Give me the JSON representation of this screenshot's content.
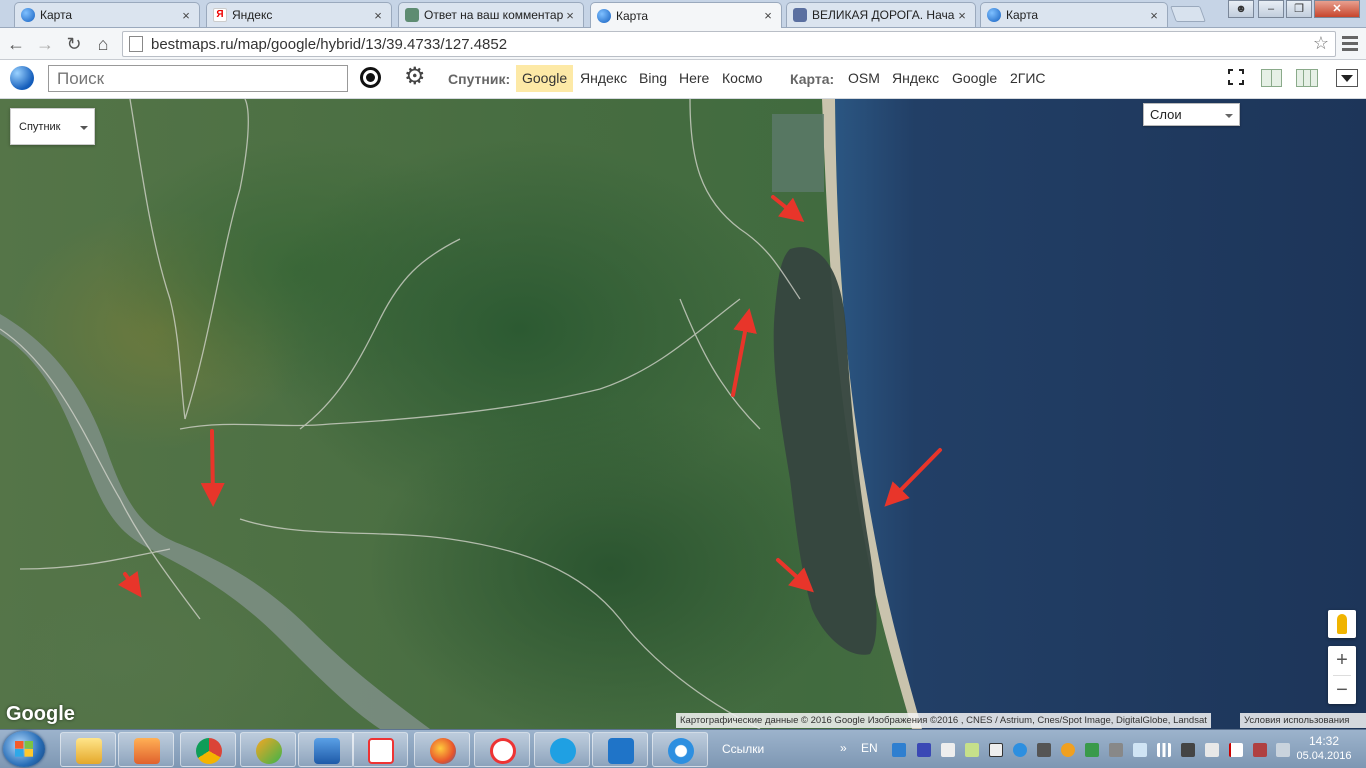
{
  "browser": {
    "tabs": [
      {
        "label": "Карта",
        "icon": "globe-icon"
      },
      {
        "label": "Яндекс",
        "icon": "yandex-icon"
      },
      {
        "label": "Ответ на ваш комментар",
        "icon": "chat-icon"
      },
      {
        "label": "Карта",
        "icon": "globe-icon",
        "active": true
      },
      {
        "label": "ВЕЛИКАЯ ДОРОГА. Нача",
        "icon": "person-icon"
      },
      {
        "label": "Карта",
        "icon": "globe-icon"
      }
    ],
    "close_glyph": "×",
    "address": {
      "url": "bestmaps.ru/map/google/hybrid/13/39.4733/127.4852"
    }
  },
  "site": {
    "search": {
      "placeholder": "Поиск"
    },
    "satellite_label": "Спутник:",
    "satellite_items": [
      "Google",
      "Яндекс",
      "Bing",
      "Here",
      "Космо"
    ],
    "satellite_selected": "Google",
    "map_label": "Карта:",
    "map_items": [
      "OSM",
      "Яндекс",
      "Google",
      "2ГИС"
    ]
  },
  "map": {
    "layer_select": "Спутник",
    "layers_button": "Слои",
    "watermark": "Google",
    "attribution": "Картографические данные © 2016 Google Изображения ©2016 , CNES / Astrium, Cnes/Spot Image, DigitalGlobe, Landsat",
    "terms": "Условия использования",
    "zoom_in": "+",
    "zoom_out": "−",
    "colors": {
      "sea": "#213c62",
      "arrow": "#e8352a",
      "lagoon": "#3a4a48",
      "beach": "#c9c3ad"
    }
  },
  "taskbar": {
    "links": "Ссылки",
    "lang": "EN",
    "clock": {
      "time": "14:32",
      "date": "05.04.2016"
    },
    "apps": [
      "explorer-icon",
      "media-player-icon",
      "chrome-icon",
      "game-icon",
      "volume-app-icon",
      "yandex-app-icon",
      "firefox-icon",
      "yandex-browser-icon",
      "skype-icon",
      "teamviewer-icon",
      "ie-icon"
    ]
  }
}
